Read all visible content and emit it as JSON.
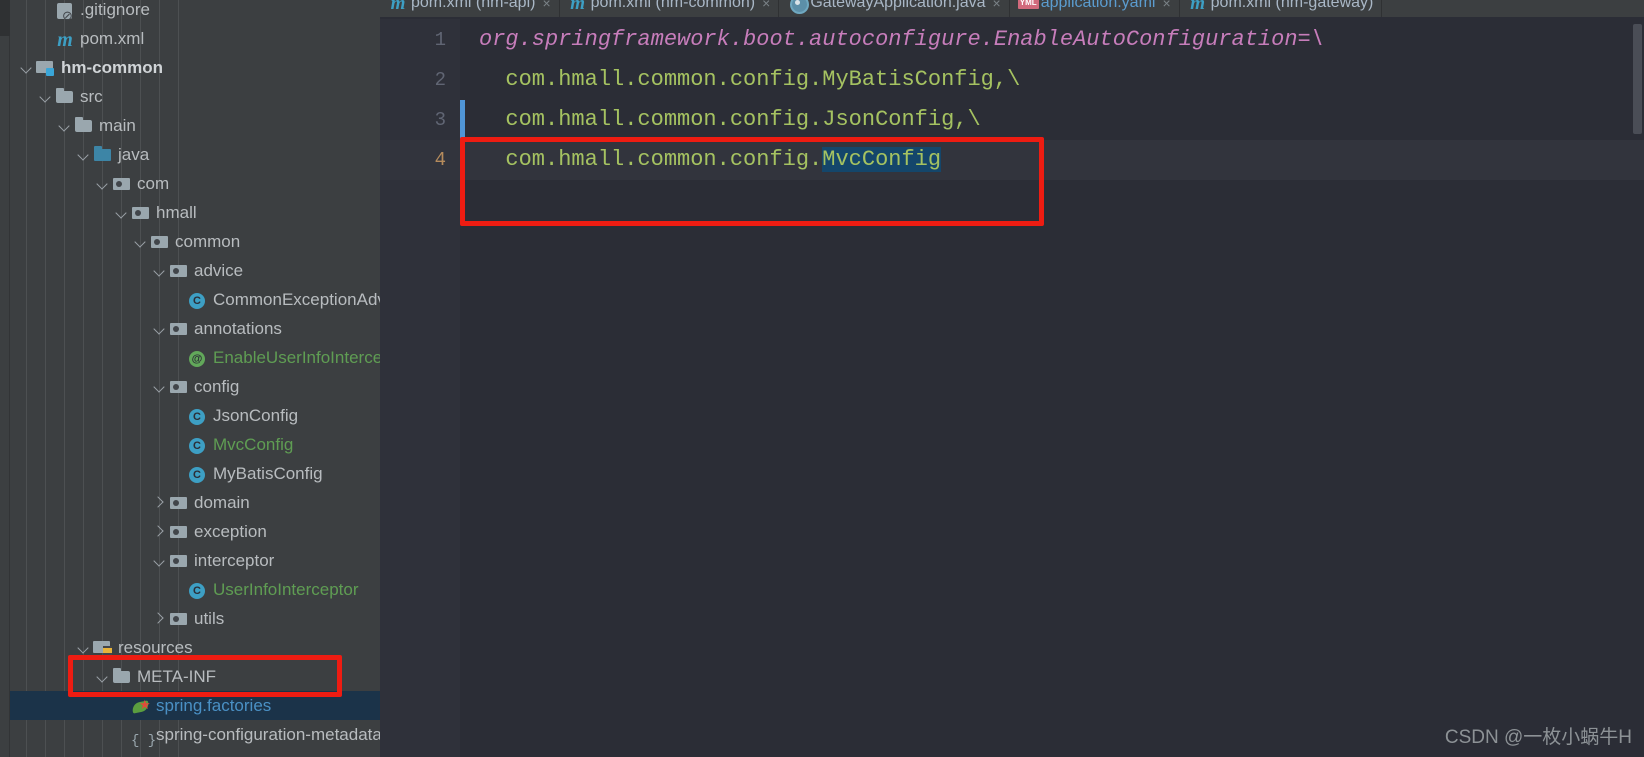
{
  "window": {
    "watermark": "CSDN @一枚小蜗牛H",
    "accent_blue": "#4a90c4",
    "selection_bg": "#1b3349",
    "annotation_red": "#ee1c12",
    "editor_bg": "#2b2d36",
    "sidebar_bg": "#3c3f41"
  },
  "sidebar": {
    "name": "project-tree",
    "items": [
      {
        "label": ".gitignore",
        "depth": 2,
        "arrow": "none",
        "icon": "git-icon",
        "style": "plain",
        "selected": false,
        "clipped_top": true
      },
      {
        "label": "pom.xml",
        "depth": 2,
        "arrow": "none",
        "icon": "maven-file-icon",
        "style": "plain",
        "selected": false
      },
      {
        "label": "hm-common",
        "depth": 1,
        "arrow": "down",
        "icon": "module-folder-icon",
        "style": "bold",
        "selected": false
      },
      {
        "label": "src",
        "depth": 2,
        "arrow": "down",
        "icon": "folder-icon",
        "style": "plain",
        "selected": false
      },
      {
        "label": "main",
        "depth": 3,
        "arrow": "down",
        "icon": "folder-icon",
        "style": "plain",
        "selected": false
      },
      {
        "label": "java",
        "depth": 4,
        "arrow": "down",
        "icon": "source-root-folder-icon",
        "style": "plain",
        "selected": false
      },
      {
        "label": "com",
        "depth": 5,
        "arrow": "down",
        "icon": "package-icon",
        "style": "plain",
        "selected": false
      },
      {
        "label": "hmall",
        "depth": 6,
        "arrow": "down",
        "icon": "package-icon",
        "style": "plain",
        "selected": false
      },
      {
        "label": "common",
        "depth": 7,
        "arrow": "down",
        "icon": "package-icon",
        "style": "plain",
        "selected": false
      },
      {
        "label": "advice",
        "depth": 8,
        "arrow": "down",
        "icon": "package-icon",
        "style": "plain",
        "selected": false
      },
      {
        "label": "CommonExceptionAdvice",
        "depth": 9,
        "arrow": "none",
        "icon": "java-class-icon",
        "style": "plain",
        "selected": false
      },
      {
        "label": "annotations",
        "depth": 8,
        "arrow": "down",
        "icon": "package-icon",
        "style": "plain",
        "selected": false
      },
      {
        "label": "EnableUserInfoIntercept",
        "depth": 9,
        "arrow": "none",
        "icon": "annotation-icon",
        "style": "green",
        "selected": false
      },
      {
        "label": "config",
        "depth": 8,
        "arrow": "down",
        "icon": "package-icon",
        "style": "plain",
        "selected": false
      },
      {
        "label": "JsonConfig",
        "depth": 9,
        "arrow": "none",
        "icon": "java-class-icon",
        "style": "plain",
        "selected": false
      },
      {
        "label": "MvcConfig",
        "depth": 9,
        "arrow": "none",
        "icon": "java-class-icon",
        "style": "green",
        "selected": false
      },
      {
        "label": "MyBatisConfig",
        "depth": 9,
        "arrow": "none",
        "icon": "java-class-icon",
        "style": "plain",
        "selected": false
      },
      {
        "label": "domain",
        "depth": 8,
        "arrow": "right",
        "icon": "package-icon",
        "style": "plain",
        "selected": false
      },
      {
        "label": "exception",
        "depth": 8,
        "arrow": "right",
        "icon": "package-icon",
        "style": "plain",
        "selected": false
      },
      {
        "label": "interceptor",
        "depth": 8,
        "arrow": "down",
        "icon": "package-icon",
        "style": "plain",
        "selected": false
      },
      {
        "label": "UserInfoInterceptor",
        "depth": 9,
        "arrow": "none",
        "icon": "java-class-icon",
        "style": "green",
        "selected": false
      },
      {
        "label": "utils",
        "depth": 8,
        "arrow": "right",
        "icon": "package-icon",
        "style": "plain",
        "selected": false
      },
      {
        "label": "resources",
        "depth": 4,
        "arrow": "down",
        "icon": "resources-folder-icon",
        "style": "plain",
        "selected": false
      },
      {
        "label": "META-INF",
        "depth": 5,
        "arrow": "down",
        "icon": "folder-icon",
        "style": "plain",
        "selected": false
      },
      {
        "label": "spring.factories",
        "depth": 6,
        "arrow": "none",
        "icon": "spring-leaf-icon",
        "style": "link",
        "selected": true
      },
      {
        "label": "spring-configuration-metadata",
        "depth": 6,
        "arrow": "none",
        "icon": "metadata-json-icon",
        "style": "plain",
        "selected": false,
        "clipped_bottom": true
      }
    ]
  },
  "tabs": [
    {
      "label": "pom.xml (hm-api)",
      "icon": "maven-file-icon",
      "active": false,
      "link": false,
      "close": "×"
    },
    {
      "label": "pom.xml (hm-common)",
      "icon": "maven-file-icon",
      "active": false,
      "link": false,
      "close": "×"
    },
    {
      "label": "GatewayApplication.java",
      "icon": "spring-boot-icon",
      "active": false,
      "link": false,
      "close": "×"
    },
    {
      "label": "application.yaml",
      "icon": "yaml-file-icon",
      "active": false,
      "link": true,
      "close": "×"
    },
    {
      "label": "pom.xml (hm-gateway)",
      "icon": "maven-file-icon",
      "active": false,
      "link": false,
      "close": ""
    }
  ],
  "editor": {
    "name": "spring-factories-editor",
    "lines": [
      {
        "number": "1",
        "kind": "key",
        "text": "org.springframework.boot.autoconfigure.EnableAutoConfiguration=\\",
        "current": false,
        "changed": false
      },
      {
        "number": "2",
        "kind": "value",
        "text": "  com.hmall.common.config.MyBatisConfig,\\",
        "current": false,
        "changed": false
      },
      {
        "number": "3",
        "kind": "value",
        "text": "  com.hmall.common.config.JsonConfig,\\",
        "current": false,
        "changed": true
      },
      {
        "number": "4",
        "kind": "value",
        "text": "  com.hmall.common.config.",
        "selected_text": "MvcConfig",
        "current": true,
        "changed": true
      }
    ]
  },
  "annotations": [
    {
      "name": "code-highlight-box",
      "target": "editor line 4 region"
    },
    {
      "name": "file-highlight-box",
      "target": "spring.factories tree row"
    }
  ]
}
